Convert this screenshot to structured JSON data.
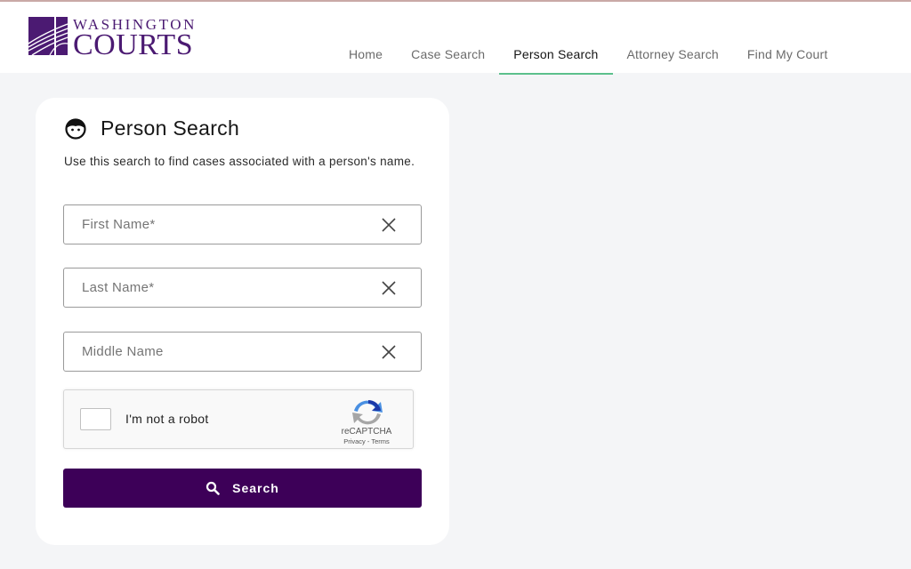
{
  "brand": {
    "line1": "WASHINGTON",
    "line2": "COURTS",
    "color": "#4b1a72"
  },
  "nav": {
    "items": [
      {
        "label": "Home",
        "active": false
      },
      {
        "label": "Case Search",
        "active": false
      },
      {
        "label": "Person Search",
        "active": true
      },
      {
        "label": "Attorney Search",
        "active": false
      },
      {
        "label": "Find My Court",
        "active": false
      }
    ],
    "active_underline_color": "#5cc08c"
  },
  "card": {
    "icon": "person-face-icon",
    "title": "Person Search",
    "description": "Use this search to find cases associated with a person's name.",
    "fields": [
      {
        "name": "first-name",
        "placeholder": "First Name*",
        "value": ""
      },
      {
        "name": "last-name",
        "placeholder": "Last Name*",
        "value": ""
      },
      {
        "name": "middle-name",
        "placeholder": "Middle Name",
        "value": ""
      }
    ],
    "recaptcha": {
      "label": "I'm not a robot",
      "brand": "reCAPTCHA",
      "links": "Privacy - Terms",
      "checked": false
    },
    "search_button": {
      "label": "Search",
      "icon": "search-icon",
      "color": "#3d0058"
    }
  }
}
